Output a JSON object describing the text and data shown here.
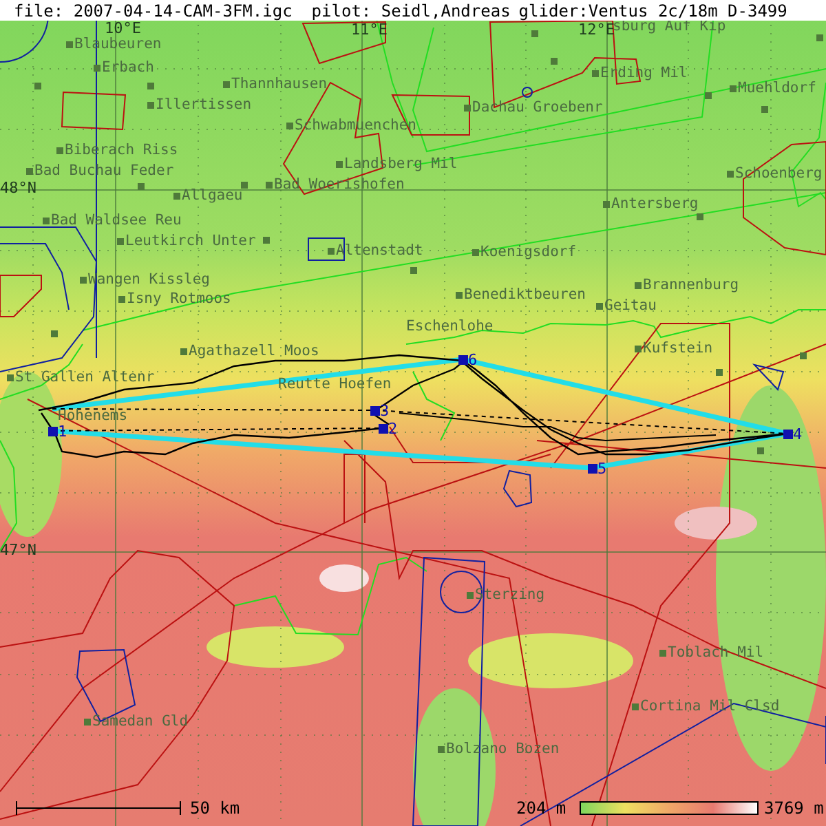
{
  "header": {
    "file": "file: 2007-04-14-CAM-3FM.igc",
    "pilot": "pilot: Seidl,Andreas",
    "glider": "glider:Ventus 2c/18m D-3499"
  },
  "grid_labels": [
    "10°E",
    "11°E",
    "12°E",
    "48°N",
    "47°N"
  ],
  "places": [
    "sburg Auf Kip",
    "Blaubeuren",
    "Erbach",
    "Thannhausen",
    "Illertissen",
    "Schwabmuenchen",
    "Landsberg Mil",
    "Biberach Riss",
    "Bad Buchau Feder",
    "Bad Woerishofen",
    "Allgaeu",
    "Bad Waldsee Reu",
    "Leutkirch Unter",
    "Altenstadt",
    "Dachau Groebenr",
    "Erding Mil",
    "Muehldorf",
    "Schoenberg",
    "Antersberg",
    "Koenigsdorf",
    "Wangen Kissleg",
    "Isny Rotmoos",
    "Benediktbeuren",
    "Brannenburg",
    "Geitau",
    "Eschenlohe",
    "Kufstein",
    "Agathazell Moos",
    "St Gallen Altenr",
    "Reutte Hoefen",
    "Hohenems",
    "Samedan Gld",
    "Sterzing",
    "Toblach Mil",
    "Cortina Mil Clsd",
    "Bolzano Bozen"
  ],
  "turnpoints": [
    "1",
    "2",
    "3",
    "4",
    "5",
    "6"
  ],
  "scale": {
    "distance": "50 km"
  },
  "elevation_legend": {
    "min": "204 m",
    "max": "3769 m"
  }
}
